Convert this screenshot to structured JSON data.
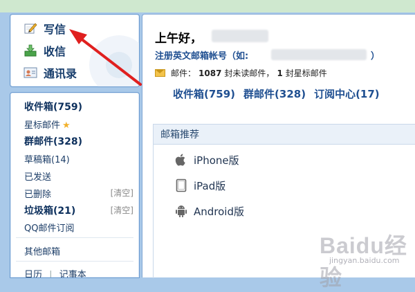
{
  "compose": {
    "write": "写信",
    "receive": "收信",
    "contacts": "通讯录"
  },
  "folders": {
    "inbox": "收件箱(759)",
    "starred": "星标邮件",
    "group": "群邮件(328)",
    "drafts": "草稿箱(14)",
    "sent": "已发送",
    "deleted": "已删除",
    "deleted_clear": "[清空]",
    "junk": "垃圾箱(21)",
    "junk_clear": "[清空]",
    "qq_subscribe": "QQ邮件订阅",
    "other_mailbox": "其他邮箱",
    "calendar": "日历",
    "divider": "|",
    "notepad": "记事本"
  },
  "main": {
    "greeting": "上午好，",
    "register_prefix": "注册英文邮箱帐号（如:",
    "register_suffix": "）",
    "mail_label": "邮件：",
    "unread_count": "1087",
    "unread_text": "封未读邮件，",
    "starred_count": "1",
    "starred_text": "封星标邮件",
    "quick_inbox": "收件箱(759)",
    "quick_group": "群邮件(328)",
    "quick_subscribe": "订阅中心(17)"
  },
  "recommend": {
    "title": "邮箱推荐",
    "items": [
      "iPhone版",
      "iPad版",
      "Android版"
    ]
  },
  "watermark": {
    "brand": "Baidu经验",
    "url": "jingyan.baidu.com"
  },
  "colors": {
    "accent": "#1f4f91",
    "annotation": "#e0201f",
    "frame": "#a9c9e9"
  },
  "icons": [
    "pencil-icon",
    "inbox-download-icon",
    "contacts-card-icon",
    "star-icon",
    "envelope-icon",
    "apple-icon",
    "ipad-icon",
    "android-icon"
  ]
}
